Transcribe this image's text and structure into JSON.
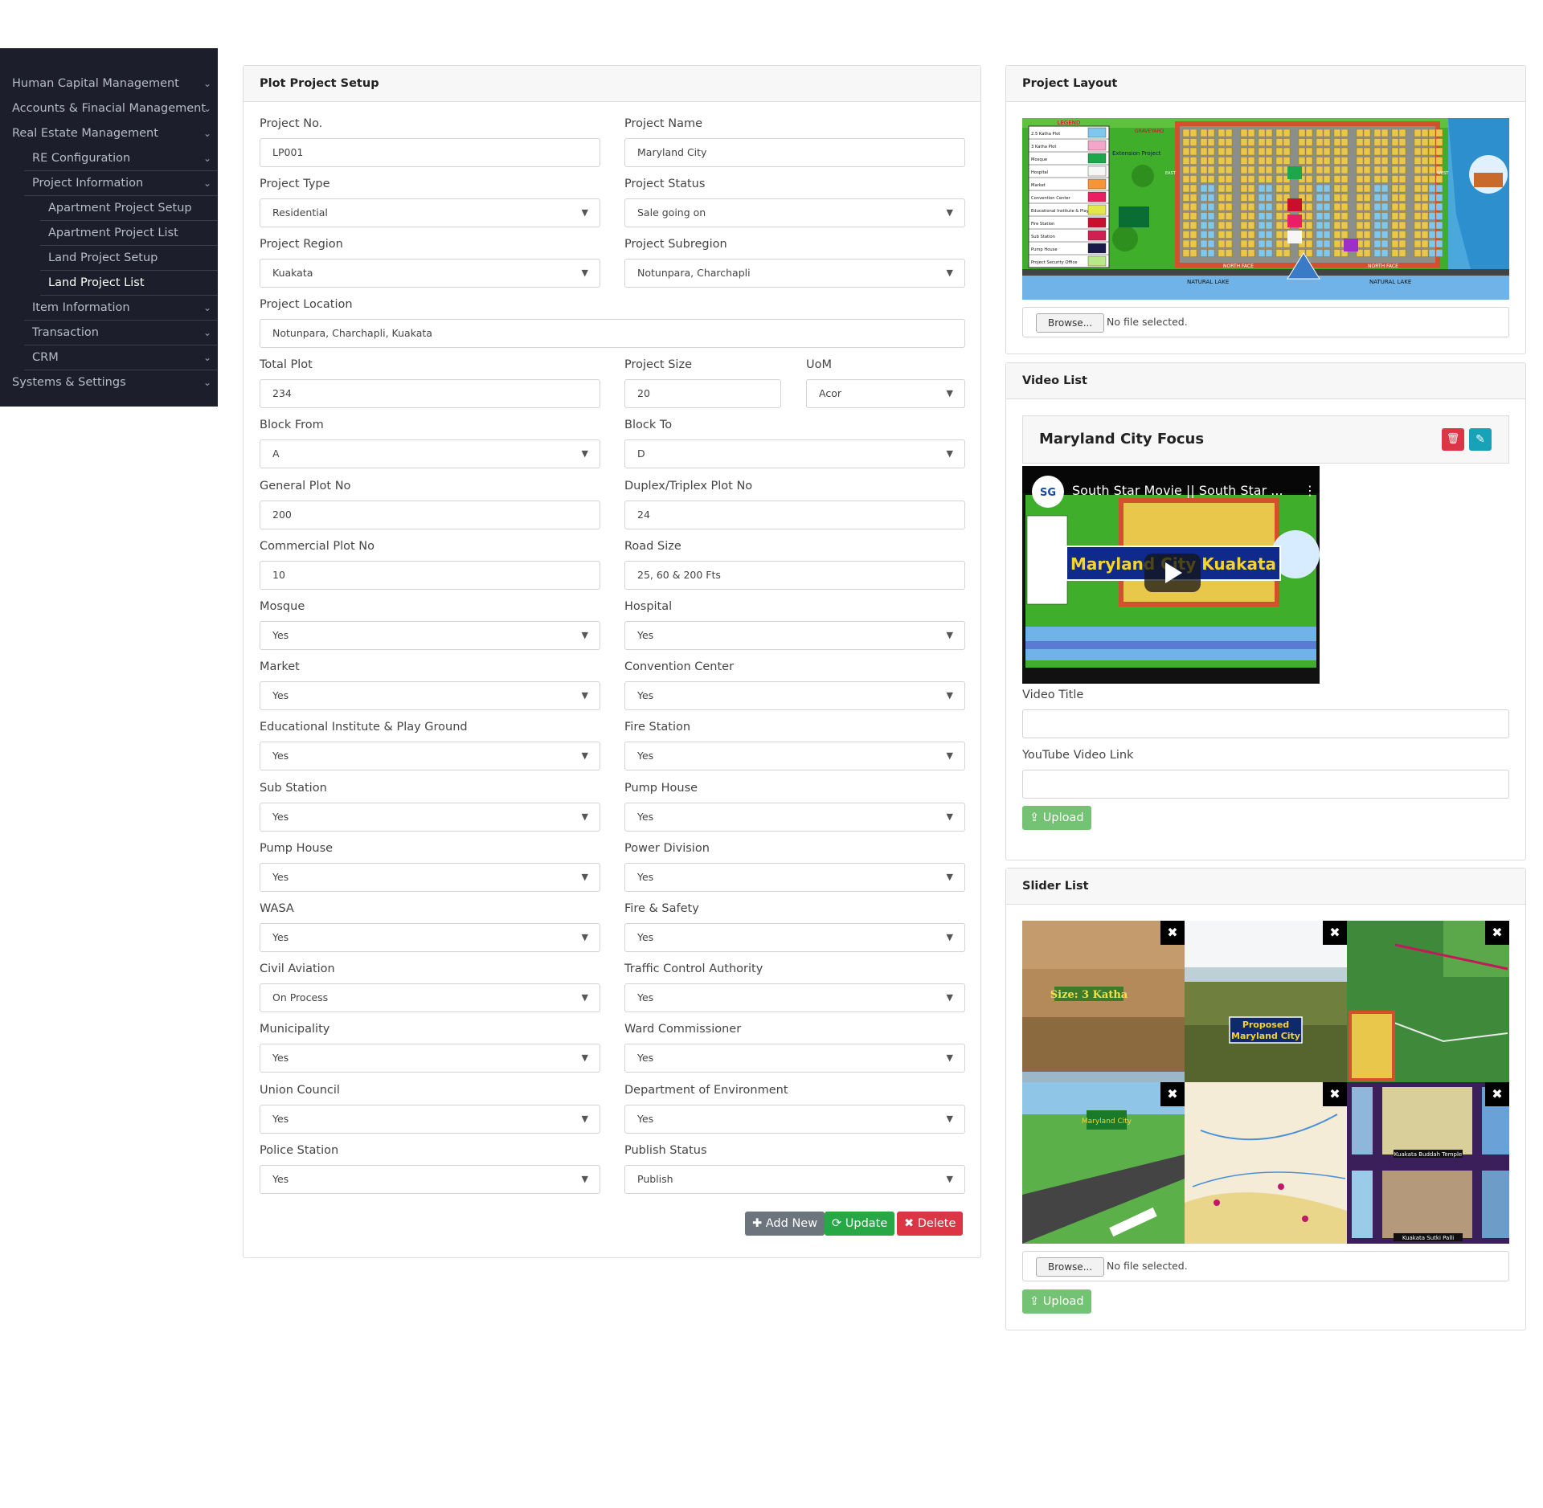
{
  "sidebar": {
    "items": [
      {
        "label": "Human Capital Management"
      },
      {
        "label": "Accounts & Finacial Management"
      },
      {
        "label": "Real Estate Management"
      },
      {
        "label": "RE Configuration"
      },
      {
        "label": "Project Information"
      },
      {
        "label": "Apartment Project Setup"
      },
      {
        "label": "Apartment Project List"
      },
      {
        "label": "Land Project Setup"
      },
      {
        "label": "Land Project List"
      },
      {
        "label": "Item Information"
      },
      {
        "label": "Transaction"
      },
      {
        "label": "CRM"
      },
      {
        "label": "Systems & Settings"
      }
    ]
  },
  "form": {
    "title": "Plot Project Setup",
    "fields": {
      "project_no": {
        "label": "Project No.",
        "value": "LP001"
      },
      "project_name": {
        "label": "Project Name",
        "value": "Maryland City"
      },
      "project_type": {
        "label": "Project Type",
        "value": "Residential"
      },
      "project_status": {
        "label": "Project Status",
        "value": "Sale going on"
      },
      "project_region": {
        "label": "Project Region",
        "value": "Kuakata"
      },
      "project_subregion": {
        "label": "Project Subregion",
        "value": "Notunpara, Charchapli"
      },
      "project_location": {
        "label": "Project Location",
        "value": "Notunpara, Charchapli, Kuakata"
      },
      "total_plot": {
        "label": "Total Plot",
        "value": "234"
      },
      "project_size": {
        "label": "Project Size",
        "value": "20"
      },
      "uom": {
        "label": "UoM",
        "value": "Acor"
      },
      "block_from": {
        "label": "Block From",
        "value": "A"
      },
      "block_to": {
        "label": "Block To",
        "value": "D"
      },
      "general_plot_no": {
        "label": "General Plot No",
        "value": "200"
      },
      "duplex_plot_no": {
        "label": "Duplex/Triplex Plot No",
        "value": "24"
      },
      "commercial_plot_no": {
        "label": "Commercial Plot No",
        "value": "10"
      },
      "road_size": {
        "label": "Road Size",
        "value": "25, 60 & 200 Fts"
      },
      "mosque": {
        "label": "Mosque",
        "value": "Yes"
      },
      "hospital": {
        "label": "Hospital",
        "value": "Yes"
      },
      "market": {
        "label": "Market",
        "value": "Yes"
      },
      "convention_center": {
        "label": "Convention Center",
        "value": "Yes"
      },
      "educational": {
        "label": "Educational Institute & Play Ground",
        "value": "Yes"
      },
      "fire_station": {
        "label": "Fire Station",
        "value": "Yes"
      },
      "sub_station": {
        "label": "Sub Station",
        "value": "Yes"
      },
      "pump_house_a": {
        "label": "Pump House",
        "value": "Yes"
      },
      "pump_house_b": {
        "label": "Pump House",
        "value": "Yes"
      },
      "power_division": {
        "label": "Power Division",
        "value": "Yes"
      },
      "wasa": {
        "label": "WASA",
        "value": "Yes"
      },
      "fire_safety": {
        "label": "Fire & Safety",
        "value": "Yes"
      },
      "civil_aviation": {
        "label": "Civil Aviation",
        "value": "On Process"
      },
      "traffic_control": {
        "label": "Traffic Control Authority",
        "value": "Yes"
      },
      "municipality": {
        "label": "Municipality",
        "value": "Yes"
      },
      "ward_commissioner": {
        "label": "Ward Commissioner",
        "value": "Yes"
      },
      "union_council": {
        "label": "Union Council",
        "value": "Yes"
      },
      "dept_environment": {
        "label": "Department of Environment",
        "value": "Yes"
      },
      "police_station": {
        "label": "Police Station",
        "value": "Yes"
      },
      "publish_status": {
        "label": "Publish Status",
        "value": "Publish"
      }
    },
    "buttons": {
      "add_new": "Add New",
      "update": "Update",
      "delete": "Delete"
    }
  },
  "layout_card": {
    "title": "Project Layout",
    "browse_label": "Browse...",
    "no_file": "No file selected.",
    "map_texts": {
      "legend": "LEGEND",
      "graveyard": "GRAVEYARD",
      "extension": "Extension Project",
      "natural_lake": "NATURAL LAKE",
      "north_face": "NORTH FACE",
      "east": "EAST",
      "west": "WEST"
    },
    "legend_items": [
      {
        "label": "2.5 Katha Plot",
        "color": "#7ec8f0"
      },
      {
        "label": "3 Katha Plot",
        "color": "#f4a6c8"
      },
      {
        "label": "Mosque",
        "color": "#1aa84a"
      },
      {
        "label": "Hospital",
        "color": "#f6f6f6"
      },
      {
        "label": "Market",
        "color": "#f79433"
      },
      {
        "label": "Convention Center",
        "color": "#e91e63"
      },
      {
        "label": "Educational Institute & Play Ground",
        "color": "#e2e84a"
      },
      {
        "label": "Fire Station",
        "color": "#c8102e"
      },
      {
        "label": "Sub Station",
        "color": "#d02050"
      },
      {
        "label": "Pump House",
        "color": "#1a1a4a"
      },
      {
        "label": "Project Security Office",
        "color": "#b8e986"
      }
    ]
  },
  "video_card": {
    "title": "Video List",
    "video_heading": "Maryland City Focus",
    "video_title_bar": "South Star Movie || South Star ...",
    "video_overlay": "Maryland City Kuakata",
    "video_title_label": "Video Title",
    "video_title_value": "",
    "youtube_label": "YouTube Video Link",
    "youtube_value": "",
    "upload_label": "Upload"
  },
  "slider_card": {
    "title": "Slider List",
    "slide_texts": {
      "size": "Size: 3 Katha",
      "proposed": "Proposed Maryland City",
      "sign": "Maryland City",
      "buddha": "Kuakata Buddah Temple",
      "sutki": "Kuakata Sutki Palli"
    },
    "close_glyph": "✖",
    "browse_label": "Browse...",
    "no_file": "No file selected.",
    "upload_label": "Upload"
  },
  "colors": {
    "sidebar_bg": "#1c1f2b",
    "btn_gray": "#6c757d",
    "btn_green": "#28a745",
    "btn_red": "#dc3545",
    "btn_info": "#17a2b8"
  }
}
